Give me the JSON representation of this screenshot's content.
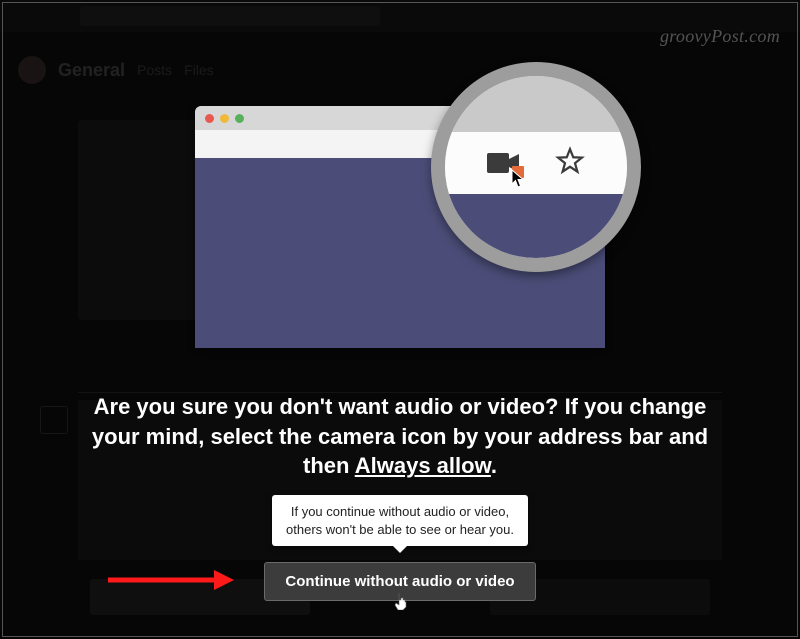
{
  "watermark": "groovyPost.com",
  "background": {
    "channel_name": "General",
    "tab1": "Posts",
    "tab2": "Files"
  },
  "dialog": {
    "headline_part1": "Are you sure you don't want audio or video? If you change your mind, select the camera icon by your address bar and then ",
    "headline_underlined": "Always allow",
    "headline_part2": ".",
    "tooltip_line1": "If you continue without audio or video,",
    "tooltip_line2": "others won't be able to see or hear you.",
    "continue_label": "Continue without audio or video"
  }
}
